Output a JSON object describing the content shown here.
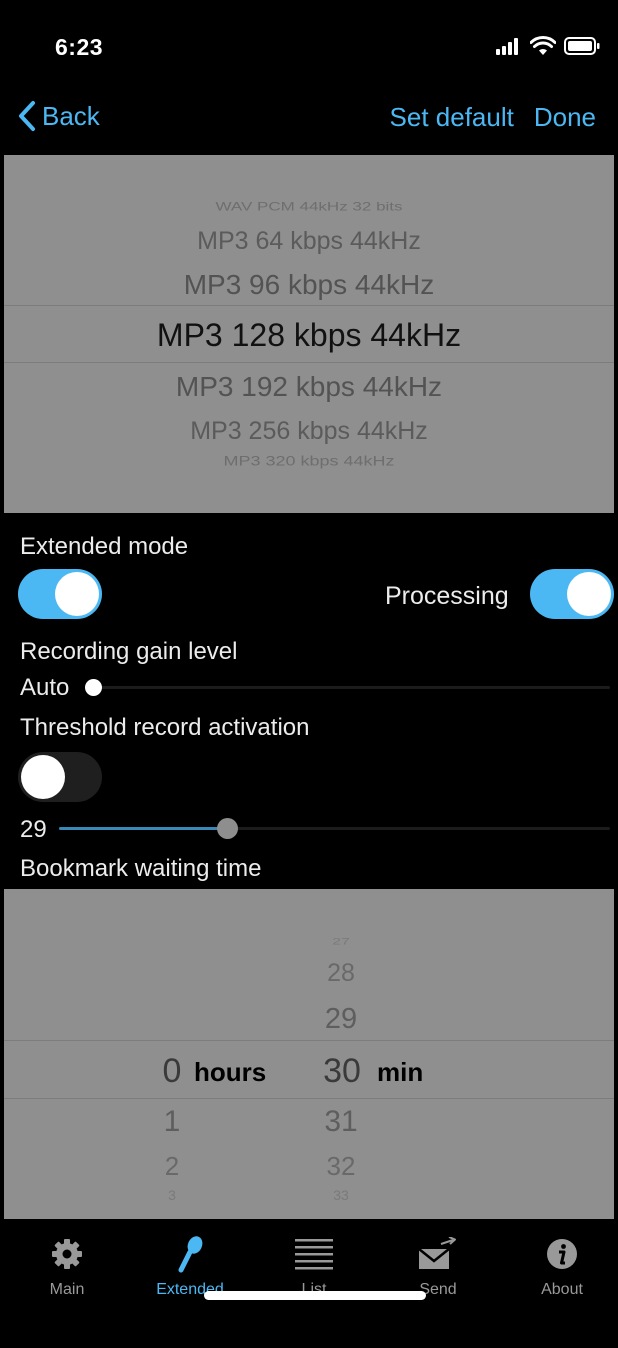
{
  "status_bar": {
    "time": "6:23"
  },
  "nav": {
    "back_label": "Back",
    "set_default_label": "Set default",
    "done_label": "Done"
  },
  "format_picker": {
    "items": [
      "WAV PCM 44kHz 32 bits",
      "MP3 64 kbps 44kHz",
      "MP3 96 kbps 44kHz",
      "MP3 128 kbps 44kHz",
      "MP3 192 kbps 44kHz",
      "MP3 256 kbps 44kHz",
      "MP3 320 kbps 44kHz"
    ],
    "selected": "MP3 128 kbps 44kHz"
  },
  "settings": {
    "extended_mode_label": "Extended mode",
    "extended_mode_on": true,
    "processing_label": "Processing",
    "processing_on": true,
    "gain_label": "Recording gain level",
    "gain_value": "Auto",
    "gain_level": 0.0,
    "threshold_label": "Threshold record activation",
    "threshold_on": false,
    "threshold_value": "29",
    "threshold_level": 0.29,
    "bookmark_label": "Bookmark waiting time"
  },
  "time_picker": {
    "hours_above": [],
    "hours_selected": "0",
    "hours_below": [
      "1",
      "2",
      "3"
    ],
    "hours_unit": "hours",
    "min_above": [
      "27",
      "28",
      "29"
    ],
    "min_selected": "30",
    "min_below": [
      "31",
      "32",
      "33"
    ],
    "min_unit": "min"
  },
  "tabs": [
    {
      "label": "Main",
      "icon": "gear-icon"
    },
    {
      "label": "Extended",
      "icon": "microphone-icon",
      "active": true
    },
    {
      "label": "List",
      "icon": "list-icon"
    },
    {
      "label": "Send",
      "icon": "send-envelope-icon"
    },
    {
      "label": "About",
      "icon": "info-icon"
    }
  ],
  "colors": {
    "accent": "#4cb8f3",
    "picker_bg": "#8f8f8f",
    "background": "#000000"
  }
}
